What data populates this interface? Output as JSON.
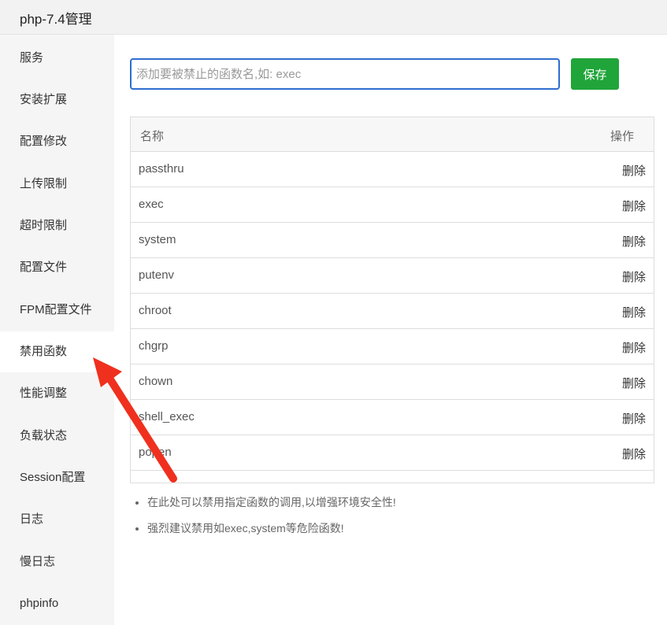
{
  "window": {
    "title": "php-7.4管理"
  },
  "sidebar": {
    "items": [
      {
        "label": "服务",
        "active": false
      },
      {
        "label": "安装扩展",
        "active": false
      },
      {
        "label": "配置修改",
        "active": false
      },
      {
        "label": "上传限制",
        "active": false
      },
      {
        "label": "超时限制",
        "active": false
      },
      {
        "label": "配置文件",
        "active": false
      },
      {
        "label": "FPM配置文件",
        "active": false
      },
      {
        "label": "禁用函数",
        "active": true
      },
      {
        "label": "性能调整",
        "active": false
      },
      {
        "label": "负载状态",
        "active": false
      },
      {
        "label": "Session配置",
        "active": false
      },
      {
        "label": "日志",
        "active": false
      },
      {
        "label": "慢日志",
        "active": false
      },
      {
        "label": "phpinfo",
        "active": false
      }
    ]
  },
  "form": {
    "input_value": "",
    "input_placeholder": "添加要被禁止的函数名,如: exec",
    "save_label": "保存"
  },
  "table": {
    "headers": {
      "name": "名称",
      "action": "操作"
    },
    "rows": [
      {
        "name": "passthru",
        "action": "删除"
      },
      {
        "name": "exec",
        "action": "删除"
      },
      {
        "name": "system",
        "action": "删除"
      },
      {
        "name": "putenv",
        "action": "删除"
      },
      {
        "name": "chroot",
        "action": "删除"
      },
      {
        "name": "chgrp",
        "action": "删除"
      },
      {
        "name": "chown",
        "action": "删除"
      },
      {
        "name": "shell_exec",
        "action": "删除"
      },
      {
        "name": "popen",
        "action": "删除"
      }
    ]
  },
  "notes": [
    "在此处可以禁用指定函数的调用,以增强环境安全性!",
    "强烈建议禁用如exec,system等危险函数!"
  ],
  "colors": {
    "accent_blue": "#2f6dcf",
    "save_green": "#20a53a",
    "arrow_red": "#f0301e"
  },
  "icons": {
    "annotation": "red-arrow-icon"
  }
}
